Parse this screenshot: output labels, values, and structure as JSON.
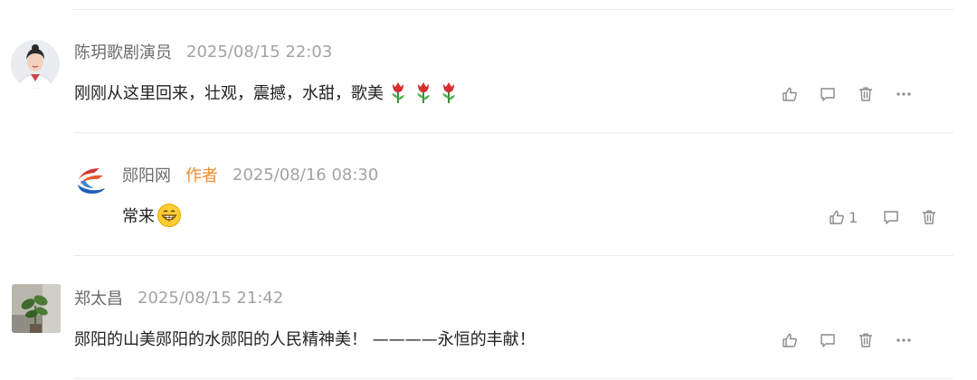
{
  "comments": [
    {
      "user": "陈玥歌剧演员",
      "time": "2025/08/15 22:03",
      "text": "刚刚从这里回来，壮观，震撼，水甜，歌美"
    },
    {
      "user": "郧阳网",
      "author_tag": "作者",
      "time": "2025/08/16 08:30",
      "text": "常来",
      "likes": "1"
    },
    {
      "user": "郑太昌",
      "time": "2025/08/15 21:42",
      "text": "郧阳的山美郧阳的水郧阳的人民精神美！ ————永恒的丰献！"
    }
  ],
  "icons": {
    "like": "thumbs-up-icon",
    "reply": "comment-icon",
    "delete": "trash-icon",
    "more": "more-icon",
    "flower": "tulip-icon",
    "emoji": "grin-emoji-icon"
  },
  "colors": {
    "author_tag": "#f08c2d",
    "username": "#6b6b6b",
    "timestamp": "#a3a3a3",
    "icon": "#8a8a8a",
    "divider": "#ebebeb"
  }
}
